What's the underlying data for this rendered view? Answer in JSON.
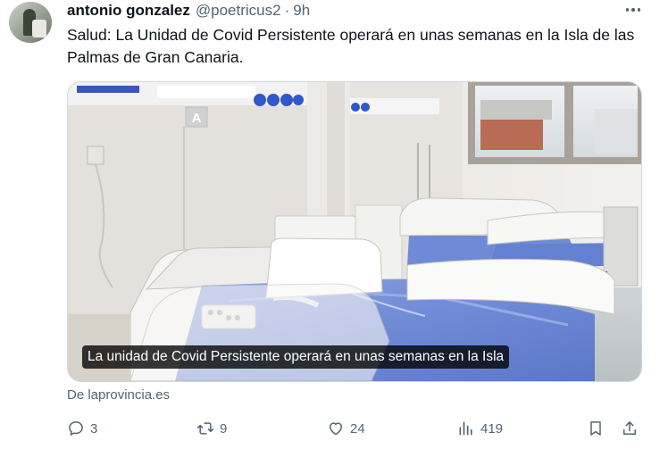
{
  "tweet": {
    "author_name": "antonio gonzalez",
    "handle": "@poetricus2",
    "separator": "·",
    "time": "9h",
    "text": "Salud: La Unidad de Covid Persistente operará en unas semanas en la Isla de las Palmas de Gran Canaria."
  },
  "card": {
    "image_caption": "La unidad de Covid Persistente operará en unas semanas en la Isla",
    "room_sign": "A",
    "source": "De laprovincia.es"
  },
  "actions": {
    "replies": "3",
    "reposts": "9",
    "likes": "24",
    "views": "419"
  },
  "icons": {
    "more": "more-icon",
    "reply": "reply-icon",
    "repost": "repost-icon",
    "like": "heart-icon",
    "views": "views-icon",
    "bookmark": "bookmark-icon",
    "share": "share-icon"
  },
  "colors": {
    "secondary_text": "#536471",
    "primary_text": "#0f1419",
    "card_border": "#cfd9de"
  }
}
